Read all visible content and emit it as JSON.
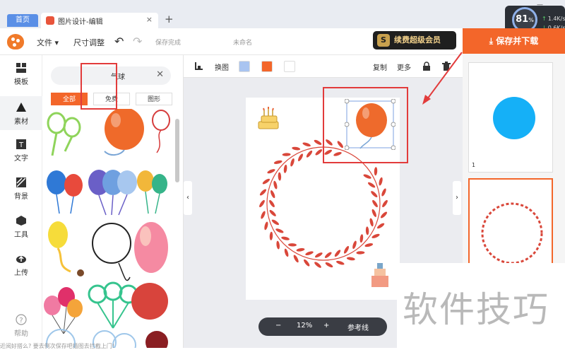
{
  "browser": {
    "home_tab": "首页",
    "doc_tab": "图片设计-编辑",
    "new_tab": "+",
    "speed": {
      "percent": "81",
      "percent_unit": "%",
      "up": "1.4K/s",
      "down": "0.6K/s"
    }
  },
  "toolbar": {
    "file": "文件 ▾",
    "resize": "尺寸调整",
    "save_status": "保存完成",
    "doc_name": "未命名",
    "vip_label": "续费超级会员",
    "vip_badge": "S",
    "save_download": "保存并下载"
  },
  "rail": {
    "items": [
      {
        "label": "模板",
        "icon": "template-icon"
      },
      {
        "label": "素材",
        "icon": "material-icon"
      },
      {
        "label": "文字",
        "icon": "text-icon"
      },
      {
        "label": "背景",
        "icon": "background-icon"
      },
      {
        "label": "工具",
        "icon": "tools-icon"
      },
      {
        "label": "上传",
        "icon": "upload-icon"
      },
      {
        "label": "帮助",
        "icon": "help-icon"
      }
    ]
  },
  "panel": {
    "search_value": "气球",
    "chips": [
      "全部",
      "免费",
      "图形"
    ]
  },
  "canvas_toolbar": {
    "swap_image": "换图",
    "swatch_colors": [
      "#a9c4f0",
      "#f3662a",
      "#ffffff"
    ],
    "copy": "复制",
    "more": "更多"
  },
  "zoom": {
    "minus": "−",
    "value": "12%",
    "plus": "+",
    "guides": "参考线"
  },
  "thumbnails": {
    "page1_number": "1"
  },
  "watermark": "软件技巧",
  "bottom_text": "近阅好搭么? 要去例次保存吧插图去拦截上门!",
  "colors": {
    "accent": "#f3662a",
    "wreath": "#d9473a",
    "balloon": "#ee6a2c",
    "circle": "#15b0f7"
  }
}
